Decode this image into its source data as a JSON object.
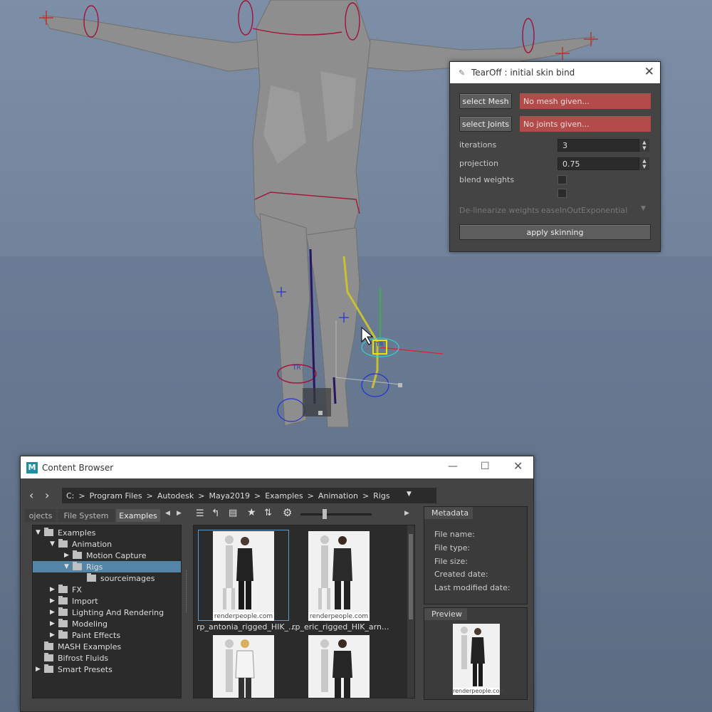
{
  "tearoff": {
    "title": "TearOff : initial skin bind",
    "select_mesh_label": "select Mesh",
    "mesh_status": "No mesh given...",
    "select_joints_label": "select Joints",
    "joints_status": "No joints given...",
    "iterations_label": "iterations",
    "iterations_value": "3",
    "projection_label": "projection",
    "projection_value": "0.75",
    "blend_weights_label": "blend weights",
    "delinearize_label": "De-linearize weights",
    "delinearize_value": "easeInOutExponential",
    "apply_label": "apply skinning",
    "status_color": "#b34b4b"
  },
  "browser": {
    "title": "Content Browser",
    "breadcrumb": [
      "C:",
      ">",
      "Program Files",
      ">",
      "Autodesk",
      ">",
      "Maya2019",
      ">",
      "Examples",
      ">",
      "Animation",
      ">",
      "Rigs"
    ],
    "tabs": [
      "ojects",
      "File System",
      "Examples"
    ],
    "tree": [
      {
        "label": "Examples",
        "depth": 0,
        "expanded": true
      },
      {
        "label": "Animation",
        "depth": 1,
        "expanded": true
      },
      {
        "label": "Motion Capture",
        "depth": 2,
        "expanded": false
      },
      {
        "label": "Rigs",
        "depth": 2,
        "expanded": true,
        "selected": true
      },
      {
        "label": "sourceimages",
        "depth": 3
      },
      {
        "label": "FX",
        "depth": 1,
        "expanded": false
      },
      {
        "label": "Import",
        "depth": 1,
        "expanded": false
      },
      {
        "label": "Lighting And Rendering",
        "depth": 1,
        "expanded": false
      },
      {
        "label": "Modeling",
        "depth": 1,
        "expanded": false
      },
      {
        "label": "Paint Effects",
        "depth": 1,
        "expanded": false
      },
      {
        "label": "MASH Examples",
        "depth": 0
      },
      {
        "label": "Bifrost Fluids",
        "depth": 0
      },
      {
        "label": "Smart Presets",
        "depth": 0,
        "expanded": false
      }
    ],
    "files": [
      {
        "caption": "rp_antonia_rigged_HIK_...",
        "watermark": "renderpeople.com"
      },
      {
        "caption": "rp_eric_rigged_HIK_arn...",
        "watermark": "renderpeople.com"
      }
    ],
    "metadata_tab": "Metadata",
    "metadata_fields": [
      "File name:",
      "File type:",
      "File size:",
      "Created date:",
      "Last modified date:"
    ],
    "preview_tab": "Preview",
    "preview_watermark": "renderpeople.com"
  },
  "viewport": {
    "manip_label": "TR"
  }
}
